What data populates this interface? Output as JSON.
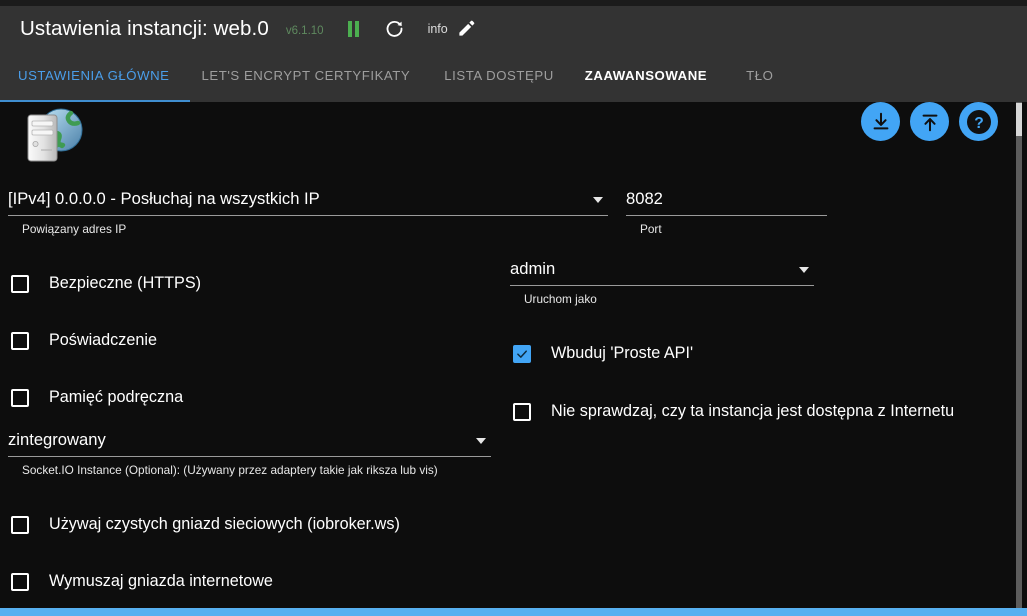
{
  "titlebar": {
    "title": "Ustawienia instancji: web.0",
    "version": "v6.1.10",
    "pause_icon": "pause-icon",
    "refresh_icon": "refresh-icon",
    "info_label": "info",
    "edit_icon": "pencil-icon"
  },
  "tabs": [
    {
      "label": "USTAWIENIA GŁÓWNE",
      "state": "active"
    },
    {
      "label": "LET'S ENCRYPT CERTYFIKATY",
      "state": "normal"
    },
    {
      "label": "LISTA DOSTĘPU",
      "state": "normal"
    },
    {
      "label": "ZAAWANSOWANE",
      "state": "hover"
    },
    {
      "label": "TŁO",
      "state": "normal"
    }
  ],
  "actions": [
    {
      "name": "download-button",
      "icon": "download-icon"
    },
    {
      "name": "upload-button",
      "icon": "upload-icon"
    },
    {
      "name": "help-button",
      "icon": "question-mark-icon"
    }
  ],
  "adapter_icon": "server-globe-icon",
  "fields": {
    "bind_ip": {
      "value": "[IPv4] 0.0.0.0 - Posłuchaj na wszystkich IP",
      "help": "Powiązany adres IP"
    },
    "port": {
      "value": "8082",
      "help": "Port"
    },
    "run_as": {
      "value": "admin",
      "help": "Uruchom jako"
    },
    "socket_io": {
      "value": "zintegrowany",
      "help": "Socket.IO Instance (Optional): (Używany przez adaptery takie jak riksza lub vis)"
    }
  },
  "checkboxes": {
    "secure_https": {
      "label": "Bezpieczne (HTTPS)",
      "checked": false
    },
    "auth": {
      "label": "Poświadczenie",
      "checked": false
    },
    "cache": {
      "label": "Pamięć podręczna",
      "checked": false
    },
    "simple_api": {
      "label": "Wbuduj 'Proste API'",
      "checked": true
    },
    "no_internet_check": {
      "label": "Nie sprawdzaj, czy ta instancja jest dostępna z Internetu",
      "checked": false
    },
    "pure_sockets": {
      "label": "Używaj czystych gniazd sieciowych (iobroker.ws)",
      "checked": false
    },
    "force_web_sockets": {
      "label": "Wymuszaj gniazda internetowe",
      "checked": false
    }
  },
  "colors": {
    "accent": "#42a5f5",
    "active_tab": "#4a9eea",
    "version": "#5f8a5f",
    "pause": "#4caf50",
    "titlebar_bg": "#333333",
    "content_bg": "#0d0d0d"
  }
}
